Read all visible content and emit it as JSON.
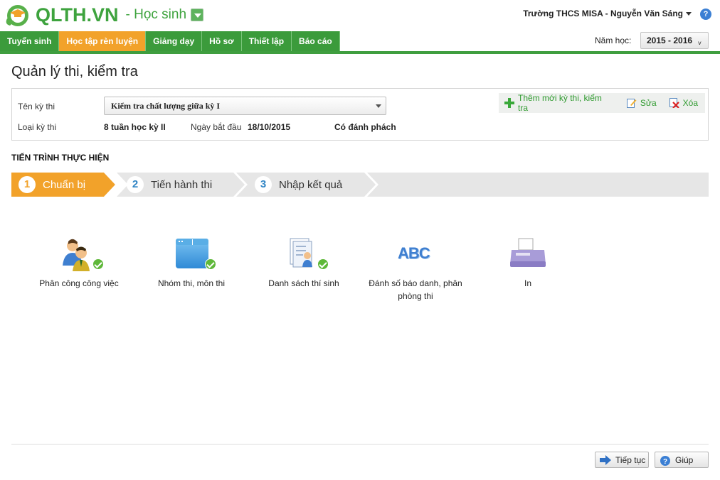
{
  "header": {
    "logo_text": "QLTH.VN",
    "role_label": "- Học sinh",
    "user": "Trường THCS MISA - Nguyễn Văn Sáng",
    "help_symbol": "?"
  },
  "nav": {
    "tabs": [
      {
        "label": "Tuyển sinh",
        "active": false
      },
      {
        "label": "Học tập rèn luyện",
        "active": true
      },
      {
        "label": "Giảng dạy",
        "active": false
      },
      {
        "label": "Hồ sơ",
        "active": false
      },
      {
        "label": "Thiết lập",
        "active": false
      },
      {
        "label": "Báo cáo",
        "active": false
      }
    ],
    "year_label": "Năm học:",
    "year_value": "2015 - 2016"
  },
  "page": {
    "title": "Quản lý thi, kiểm tra"
  },
  "exam": {
    "name_label": "Tên kỳ thi",
    "name_value": "Kiểm tra chất lượng giữa kỳ I",
    "type_label": "Loại kỳ thi",
    "type_value": "8 tuần học kỳ II",
    "start_label": "Ngày bắt đầu",
    "start_value": "18/10/2015",
    "extra_value": "Có đánh phách"
  },
  "actions": {
    "add_label": "Thêm mới kỳ thi, kiểm tra",
    "edit_label": "Sửa",
    "delete_label": "Xóa"
  },
  "progress": {
    "title": "TIẾN TRÌNH THỰC HIỆN",
    "steps": [
      {
        "num": "1",
        "label": "Chuẩn bị",
        "active": true
      },
      {
        "num": "2",
        "label": "Tiến hành thi",
        "active": false
      },
      {
        "num": "3",
        "label": "Nhập kết quả",
        "active": false
      }
    ]
  },
  "tools": [
    {
      "label": "Phân công công việc",
      "done": true,
      "icon": "people-icon"
    },
    {
      "label": "Nhóm thi, môn thi",
      "done": true,
      "icon": "folder-window-icon"
    },
    {
      "label": "Danh sách thí sinh",
      "done": true,
      "icon": "document-person-icon"
    },
    {
      "label_line1": "Đánh số báo danh, phân",
      "label_line2": "phòng thi",
      "done": false,
      "icon": "abc-icon",
      "abc_text": "ABC"
    },
    {
      "label": "In",
      "done": false,
      "icon": "printer-icon"
    }
  ],
  "footer": {
    "continue_label": "Tiếp tục",
    "help_label": "Giúp"
  },
  "colors": {
    "brand_green": "#3b9b3b",
    "active_orange": "#f2a22a",
    "step_inactive": "#e6e6e6"
  }
}
